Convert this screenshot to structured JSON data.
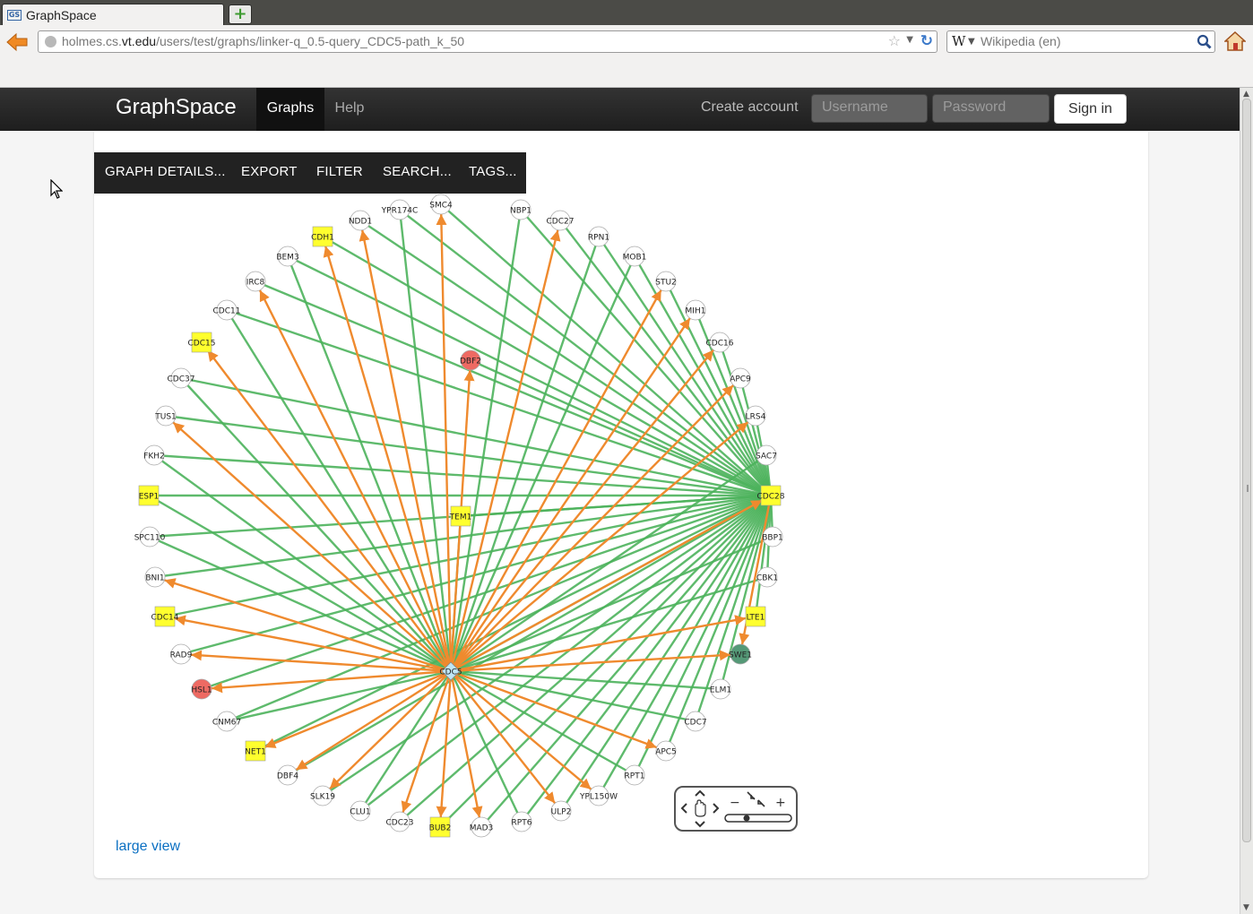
{
  "browser": {
    "tab_title": "GraphSpace",
    "favicon_text": "GS",
    "url_domain": "holmes.cs.",
    "url_domain_bold": "vt.edu",
    "url_path": "/users/test/graphs/linker-q_0.5-query_CDC5-path_k_50",
    "search_engine_glyph": "W",
    "search_placeholder": "Wikipedia (en)"
  },
  "header": {
    "brand": "GraphSpace",
    "nav": [
      "Graphs",
      "Help"
    ],
    "create_account": "Create account",
    "username_placeholder": "Username",
    "password_placeholder": "Password",
    "sign_in": "Sign in"
  },
  "toolbar": {
    "items": [
      "GRAPH DETAILS...",
      "EXPORT",
      "FILTER",
      "SEARCH...",
      "TAGS..."
    ]
  },
  "graph": {
    "center": "CDC5",
    "hub": "CDC28",
    "colors": {
      "edge_green": "#4cb35c",
      "edge_orange": "#ef8a2e",
      "node_white": "#ffffff",
      "node_yellow": "#ffff2e",
      "node_red": "#ee6a63",
      "node_darkgreen": "#559977",
      "node_lightblue": "#bfe6f5"
    },
    "nodes": [
      {
        "id": "SMC4",
        "shape": "circle",
        "color": "white"
      },
      {
        "id": "NBP1",
        "shape": "circle",
        "color": "white"
      },
      {
        "id": "CDC27",
        "shape": "circle",
        "color": "white"
      },
      {
        "id": "RPN1",
        "shape": "circle",
        "color": "white"
      },
      {
        "id": "MOB1",
        "shape": "circle",
        "color": "white"
      },
      {
        "id": "STU2",
        "shape": "circle",
        "color": "white"
      },
      {
        "id": "MIH1",
        "shape": "circle",
        "color": "white"
      },
      {
        "id": "CDC16",
        "shape": "circle",
        "color": "white"
      },
      {
        "id": "APC9",
        "shape": "circle",
        "color": "white"
      },
      {
        "id": "LRS4",
        "shape": "circle",
        "color": "white"
      },
      {
        "id": "SAC7",
        "shape": "circle",
        "color": "white"
      },
      {
        "id": "CDC28",
        "shape": "square",
        "color": "yellow"
      },
      {
        "id": "BBP1",
        "shape": "circle",
        "color": "white"
      },
      {
        "id": "CBK1",
        "shape": "circle",
        "color": "white"
      },
      {
        "id": "LTE1",
        "shape": "square",
        "color": "yellow"
      },
      {
        "id": "SWE1",
        "shape": "circle",
        "color": "darkgreen"
      },
      {
        "id": "ELM1",
        "shape": "circle",
        "color": "white"
      },
      {
        "id": "CDC7",
        "shape": "circle",
        "color": "white"
      },
      {
        "id": "APC5",
        "shape": "circle",
        "color": "white"
      },
      {
        "id": "RPT1",
        "shape": "circle",
        "color": "white"
      },
      {
        "id": "YPL150W",
        "shape": "circle",
        "color": "white"
      },
      {
        "id": "ULP2",
        "shape": "circle",
        "color": "white"
      },
      {
        "id": "RPT6",
        "shape": "circle",
        "color": "white"
      },
      {
        "id": "MAD3",
        "shape": "circle",
        "color": "white"
      },
      {
        "id": "BUB2",
        "shape": "square",
        "color": "yellow"
      },
      {
        "id": "CDC23",
        "shape": "circle",
        "color": "white"
      },
      {
        "id": "CLU1",
        "shape": "circle",
        "color": "white"
      },
      {
        "id": "SLK19",
        "shape": "circle",
        "color": "white"
      },
      {
        "id": "DBF4",
        "shape": "circle",
        "color": "white"
      },
      {
        "id": "NET1",
        "shape": "square",
        "color": "yellow"
      },
      {
        "id": "CNM67",
        "shape": "circle",
        "color": "white"
      },
      {
        "id": "HSL1",
        "shape": "circle",
        "color": "red"
      },
      {
        "id": "RAD9",
        "shape": "circle",
        "color": "white"
      },
      {
        "id": "CDC14",
        "shape": "square",
        "color": "yellow"
      },
      {
        "id": "BNI1",
        "shape": "circle",
        "color": "white"
      },
      {
        "id": "SPC110",
        "shape": "circle",
        "color": "white"
      },
      {
        "id": "ESP1",
        "shape": "square",
        "color": "yellow"
      },
      {
        "id": "FKH2",
        "shape": "circle",
        "color": "white"
      },
      {
        "id": "TUS1",
        "shape": "circle",
        "color": "white"
      },
      {
        "id": "CDC37",
        "shape": "circle",
        "color": "white"
      },
      {
        "id": "CDC15",
        "shape": "square",
        "color": "yellow"
      },
      {
        "id": "CDC11",
        "shape": "circle",
        "color": "white"
      },
      {
        "id": "IRC8",
        "shape": "circle",
        "color": "white"
      },
      {
        "id": "BEM3",
        "shape": "circle",
        "color": "white"
      },
      {
        "id": "CDH1",
        "shape": "square",
        "color": "yellow"
      },
      {
        "id": "NDD1",
        "shape": "circle",
        "color": "white"
      },
      {
        "id": "YPR174C",
        "shape": "circle",
        "color": "white"
      },
      {
        "id": "DBF2",
        "shape": "circle",
        "color": "red"
      },
      {
        "id": "TEM1",
        "shape": "square",
        "color": "yellow"
      },
      {
        "id": "CDC5",
        "shape": "diamond",
        "color": "lightblue"
      }
    ],
    "edges": [
      [
        "CDC5",
        "SMC4",
        "orange"
      ],
      [
        "CDC5",
        "NBP1",
        "green"
      ],
      [
        "CDC5",
        "CDC27",
        "orange"
      ],
      [
        "CDC5",
        "RPN1",
        "green"
      ],
      [
        "CDC5",
        "MOB1",
        "green"
      ],
      [
        "CDC5",
        "STU2",
        "orange"
      ],
      [
        "CDC5",
        "MIH1",
        "orange"
      ],
      [
        "CDC5",
        "CDC16",
        "orange"
      ],
      [
        "CDC5",
        "APC9",
        "orange"
      ],
      [
        "CDC5",
        "LRS4",
        "orange"
      ],
      [
        "CDC5",
        "SAC7",
        "green"
      ],
      [
        "CDC5",
        "CDC28",
        "orange"
      ],
      [
        "CDC5",
        "CDC28",
        "green"
      ],
      [
        "CDC5",
        "BBP1",
        "green"
      ],
      [
        "CDC5",
        "CBK1",
        "green"
      ],
      [
        "CDC5",
        "LTE1",
        "orange"
      ],
      [
        "CDC5",
        "SWE1",
        "orange"
      ],
      [
        "CDC5",
        "ELM1",
        "green"
      ],
      [
        "CDC5",
        "CDC7",
        "green"
      ],
      [
        "CDC5",
        "APC5",
        "orange"
      ],
      [
        "CDC5",
        "RPT1",
        "green"
      ],
      [
        "CDC5",
        "YPL150W",
        "orange"
      ],
      [
        "CDC5",
        "ULP2",
        "orange"
      ],
      [
        "CDC5",
        "RPT6",
        "green"
      ],
      [
        "CDC5",
        "MAD3",
        "orange"
      ],
      [
        "CDC5",
        "BUB2",
        "orange"
      ],
      [
        "CDC5",
        "CDC23",
        "orange"
      ],
      [
        "CDC5",
        "CLU1",
        "green"
      ],
      [
        "CDC5",
        "SLK19",
        "orange"
      ],
      [
        "CDC5",
        "DBF4",
        "orange"
      ],
      [
        "CDC5",
        "NET1",
        "orange"
      ],
      [
        "CDC5",
        "CNM67",
        "green"
      ],
      [
        "CDC5",
        "HSL1",
        "orange"
      ],
      [
        "CDC5",
        "RAD9",
        "orange"
      ],
      [
        "CDC5",
        "CDC14",
        "orange"
      ],
      [
        "CDC5",
        "BNI1",
        "orange"
      ],
      [
        "CDC5",
        "SPC110",
        "green"
      ],
      [
        "CDC5",
        "ESP1",
        "green"
      ],
      [
        "CDC5",
        "FKH2",
        "green"
      ],
      [
        "CDC5",
        "TUS1",
        "orange"
      ],
      [
        "CDC5",
        "CDC37",
        "green"
      ],
      [
        "CDC5",
        "CDC15",
        "orange"
      ],
      [
        "CDC5",
        "CDC11",
        "green"
      ],
      [
        "CDC5",
        "IRC8",
        "orange"
      ],
      [
        "CDC5",
        "BEM3",
        "green"
      ],
      [
        "CDC5",
        "CDH1",
        "orange"
      ],
      [
        "CDC5",
        "NDD1",
        "orange"
      ],
      [
        "CDC5",
        "YPR174C",
        "green"
      ],
      [
        "CDC5",
        "DBF2",
        "orange"
      ],
      [
        "CDC5",
        "TEM1",
        "green"
      ],
      [
        "CDC28",
        "SMC4",
        "green"
      ],
      [
        "CDC28",
        "NBP1",
        "green"
      ],
      [
        "CDC28",
        "CDC27",
        "green"
      ],
      [
        "CDC28",
        "RPN1",
        "green"
      ],
      [
        "CDC28",
        "MOB1",
        "green"
      ],
      [
        "CDC28",
        "STU2",
        "green"
      ],
      [
        "CDC28",
        "MIH1",
        "green"
      ],
      [
        "CDC28",
        "CDC16",
        "green"
      ],
      [
        "CDC28",
        "APC9",
        "green"
      ],
      [
        "CDC28",
        "LRS4",
        "green"
      ],
      [
        "CDC28",
        "SAC7",
        "green"
      ],
      [
        "CDC28",
        "BBP1",
        "green"
      ],
      [
        "CDC28",
        "CBK1",
        "green"
      ],
      [
        "CDC28",
        "LTE1",
        "green"
      ],
      [
        "CDC28",
        "SWE1",
        "orange"
      ],
      [
        "CDC28",
        "ELM1",
        "green"
      ],
      [
        "CDC28",
        "CDC7",
        "green"
      ],
      [
        "CDC28",
        "CNM67",
        "green"
      ],
      [
        "CDC28",
        "HSL1",
        "green"
      ],
      [
        "CDC28",
        "RAD9",
        "green"
      ],
      [
        "CDC28",
        "CDC14",
        "green"
      ],
      [
        "CDC28",
        "BNI1",
        "green"
      ],
      [
        "CDC28",
        "SPC110",
        "green"
      ],
      [
        "CDC28",
        "ESP1",
        "green"
      ],
      [
        "CDC28",
        "FKH2",
        "green"
      ],
      [
        "CDC28",
        "TUS1",
        "green"
      ],
      [
        "CDC28",
        "CDC37",
        "green"
      ],
      [
        "CDC28",
        "CDC11",
        "green"
      ],
      [
        "CDC28",
        "IRC8",
        "green"
      ],
      [
        "CDC28",
        "BEM3",
        "green"
      ],
      [
        "CDC28",
        "CDH1",
        "green"
      ],
      [
        "CDC28",
        "NDD1",
        "green"
      ],
      [
        "CDC28",
        "YPR174C",
        "green"
      ],
      [
        "CDC28",
        "DBF2",
        "green"
      ],
      [
        "CDC28",
        "TEM1",
        "green"
      ],
      [
        "CDC28",
        "RPT1",
        "green"
      ],
      [
        "CDC28",
        "YPL150W",
        "green"
      ],
      [
        "CDC28",
        "ULP2",
        "green"
      ],
      [
        "CDC28",
        "RPT6",
        "green"
      ],
      [
        "CDC28",
        "MAD3",
        "green"
      ],
      [
        "CDC28",
        "CDC23",
        "green"
      ],
      [
        "CDC28",
        "CLU1",
        "green"
      ],
      [
        "CDC28",
        "SLK19",
        "green"
      ],
      [
        "CDC28",
        "DBF4",
        "green"
      ],
      [
        "CDC28",
        "NET1",
        "green"
      ],
      [
        "CDC28",
        "APC5",
        "green"
      ],
      [
        "CDC28",
        "BUB2",
        "green"
      ]
    ]
  },
  "navigator_icons": {
    "pan": "hand-icon",
    "zoom_out": "−",
    "fit": "⤡",
    "zoom_in": "+"
  },
  "large_view_link": "large view"
}
